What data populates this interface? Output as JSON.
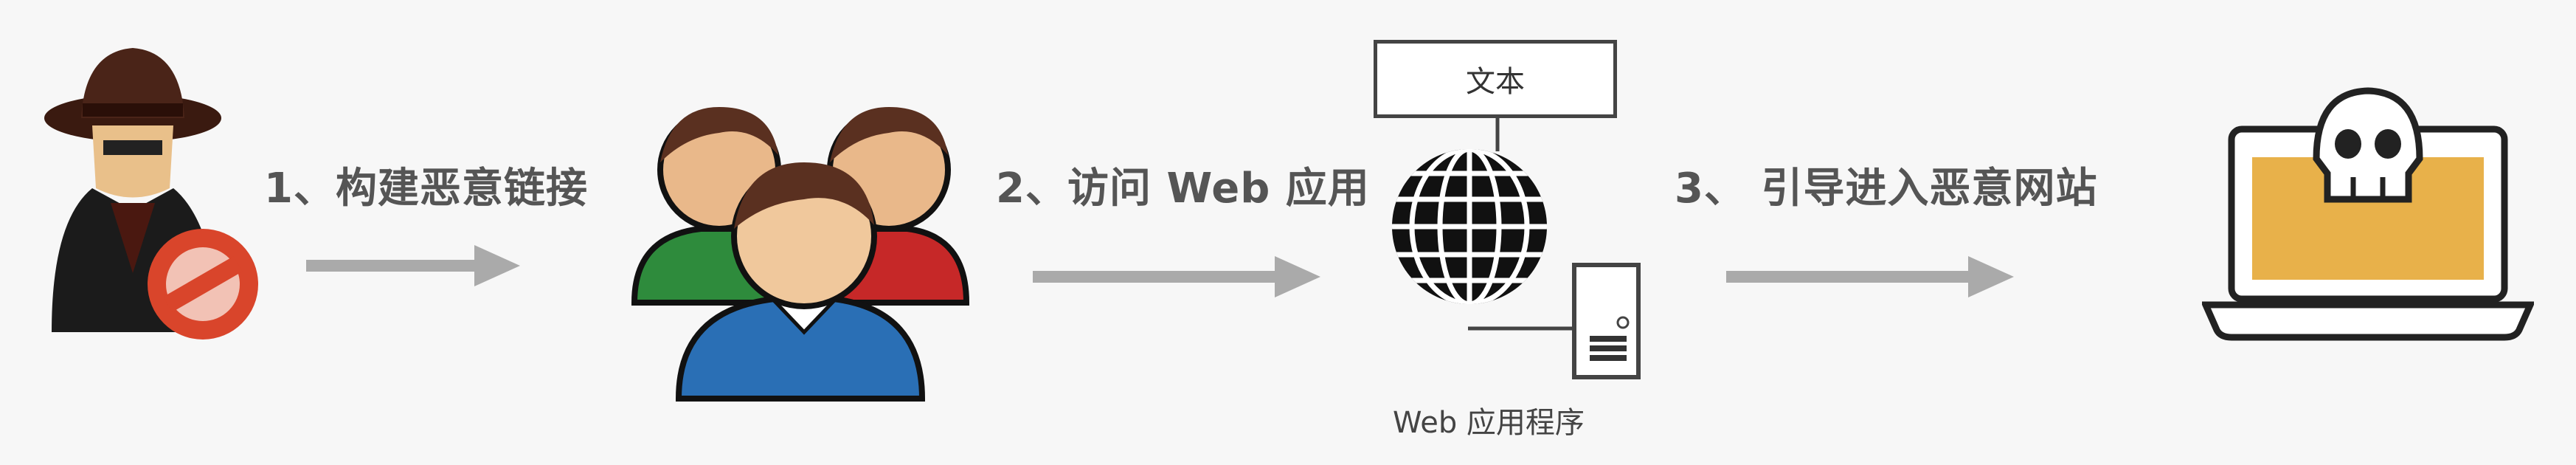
{
  "steps": [
    {
      "label": "1、构建恶意链接"
    },
    {
      "label": "2、访问 Web 应用"
    },
    {
      "label": "3、 引导进入恶意网站"
    }
  ],
  "server": {
    "box_text": "文本",
    "caption": "Web 应用程序"
  },
  "icons": [
    "hacker-icon",
    "users-group-icon",
    "globe-icon",
    "server-icon",
    "laptop-skull-icon"
  ],
  "colors": {
    "arrow": "#aaaaaa",
    "text": "#555555",
    "screen": "#e8b14a",
    "no_sign": "#d9452b"
  }
}
